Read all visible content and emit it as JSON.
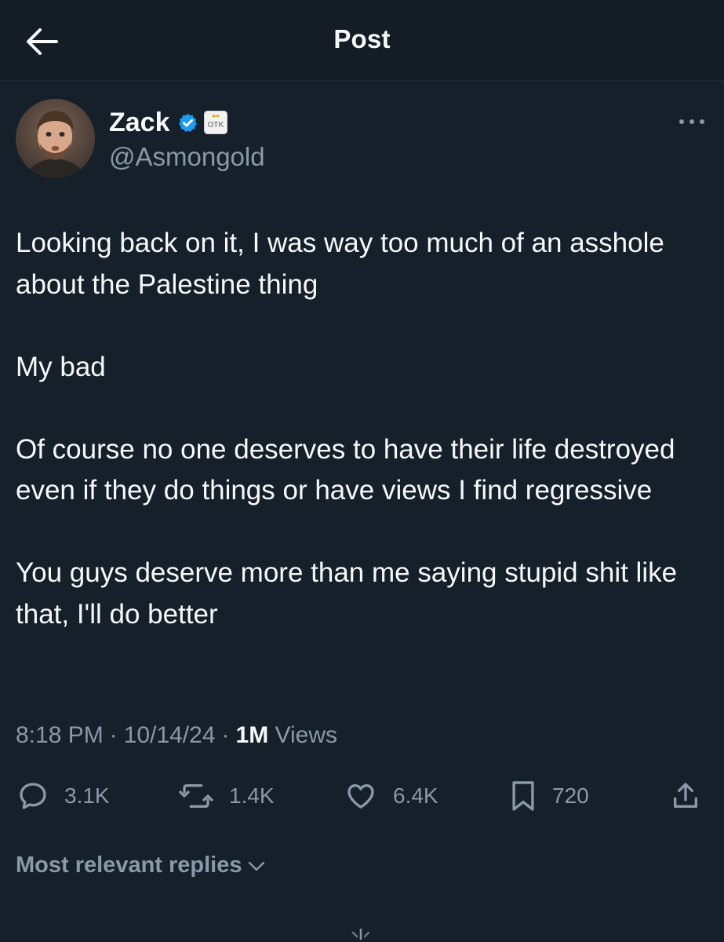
{
  "header": {
    "title": "Post"
  },
  "author": {
    "display_name": "Zack",
    "handle": "@Asmongold",
    "verified": true,
    "affiliate_badge_text": "OTK"
  },
  "post": {
    "paragraphs": [
      "Looking back on it, I was way too much of an asshole about the Palestine thing",
      "My bad",
      "Of course no one deserves to have their life destroyed even if they do things or have views I find regressive",
      "You guys deserve more than me saying stupid shit like that, I'll do better"
    ],
    "time": "8:18 PM",
    "date": "10/14/24",
    "views_count": "1M",
    "views_label": "Views"
  },
  "actions": {
    "replies": "3.1K",
    "reposts": "1.4K",
    "likes": "6.4K",
    "bookmarks": "720"
  },
  "replies_sort": {
    "label": "Most relevant replies"
  },
  "icons": {
    "back": "arrow-left-icon",
    "verified": "verified-badge-icon",
    "more": "more-horizontal-icon",
    "reply": "reply-icon",
    "repost": "repost-icon",
    "like": "heart-icon",
    "bookmark": "bookmark-icon",
    "share": "share-icon",
    "chevron": "chevron-down-icon",
    "loading": "loading-spinner-icon"
  },
  "colors": {
    "background": "#15202b",
    "header_background": "#141d26",
    "text_primary": "#f7f9f9",
    "text_secondary": "#8b98a5",
    "verified_blue": "#1d9bf0"
  }
}
